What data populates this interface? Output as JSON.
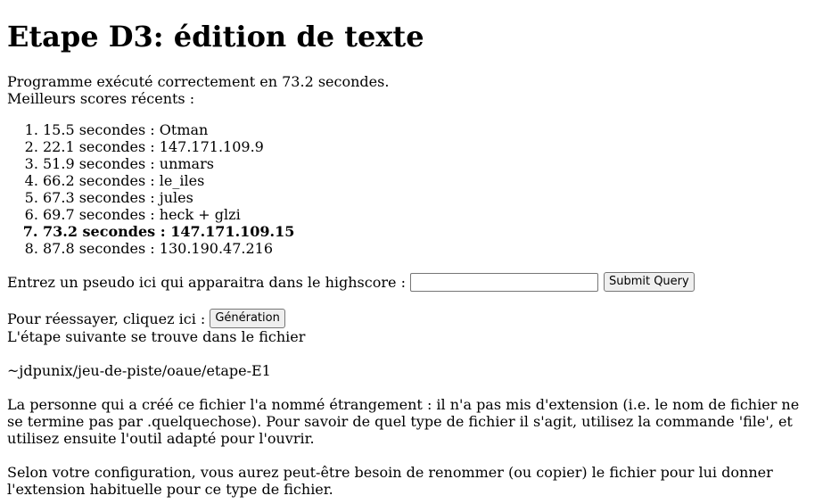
{
  "heading": "Etape D3: édition de texte",
  "result": {
    "executed": "Programme exécuté correctement en 73.2 secondes.",
    "best_label": "Meilleurs scores récents :"
  },
  "scores": [
    {
      "text": "15.5 secondes : Otman",
      "current": false
    },
    {
      "text": "22.1 secondes : 147.171.109.9",
      "current": false
    },
    {
      "text": "51.9 secondes : unmars",
      "current": false
    },
    {
      "text": "66.2 secondes : le_iles",
      "current": false
    },
    {
      "text": "67.3 secondes : jules",
      "current": false
    },
    {
      "text": "69.7 secondes : heck + glzi",
      "current": false
    },
    {
      "text": "73.2 secondes : 147.171.109.15",
      "current": true
    },
    {
      "text": "87.8 secondes : 130.190.47.216",
      "current": false
    }
  ],
  "form": {
    "pseudo_label": "Entrez un pseudo ici qui apparaitra dans le highscore :",
    "pseudo_value": "",
    "submit_label": "Submit Query"
  },
  "retry": {
    "label": "Pour réessayer, cliquez ici :",
    "button_label": "Génération"
  },
  "instructions": {
    "next_step": "L'étape suivante se trouve dans le fichier",
    "path": "~jdpunix/jeu-de-piste/oaue/etape-E1",
    "paragraph1": "La personne qui a créé ce fichier l'a nommé étrangement : il n'a pas mis d'extension (i.e. le nom de fichier ne se termine pas par .quelquechose). Pour savoir de quel type de fichier il s'agit, utilisez la commande 'file', et utilisez ensuite l'outil adapté pour l'ouvrir.",
    "paragraph2": "Selon votre configuration, vous aurez peut-être besoin de renommer (ou copier) le fichier pour lui donner l'extension habituelle pour ce type de fichier."
  }
}
